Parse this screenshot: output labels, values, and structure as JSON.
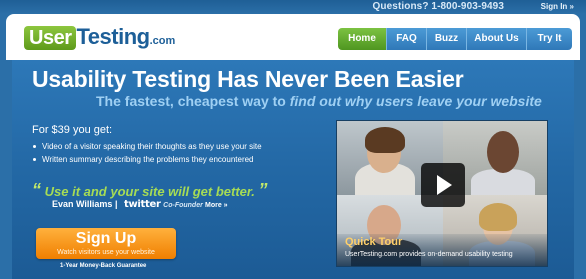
{
  "topbar": {
    "questions": "Questions? 1-800-903-9493",
    "sign_in": "Sign In »"
  },
  "logo": {
    "user": "User",
    "testing": "Testing",
    "com": ".com"
  },
  "nav": {
    "items": [
      {
        "label": "Home",
        "active": true
      },
      {
        "label": "FAQ",
        "active": false
      },
      {
        "label": "Buzz",
        "active": false
      },
      {
        "label": "About Us",
        "active": false
      },
      {
        "label": "Try It",
        "active": false
      }
    ]
  },
  "hero": {
    "headline": "Usability Testing Has Never Been Easier",
    "subhead_plain": "The fastest, cheapest way to ",
    "subhead_italic": "find out why users leave your website",
    "offer_intro": "For $39 you get:",
    "bullets": [
      "Video of a visitor speaking their thoughts as they use your site",
      "Written summary describing the problems they encountered"
    ],
    "quote_open": "“",
    "quote_text": "Use it and your site will get better.",
    "quote_close": "”",
    "attribution_name": "Evan Williams",
    "attribution_sep": "|",
    "attribution_company": "twitter",
    "attribution_role": "Co-Founder",
    "more_link": "More »",
    "signup_label": "Sign Up",
    "signup_sub": "Watch visitors use your website",
    "guarantee": "1-Year Money-Back Guarantee"
  },
  "video": {
    "title": "Quick Tour",
    "description": "UserTesting.com provides on-demand usability testing"
  },
  "colors": {
    "brand_blue": "#2368a5",
    "nav_active": "#5ea52a",
    "signup_orange": "#f49a1e",
    "quote_green": "#a6dc55"
  }
}
